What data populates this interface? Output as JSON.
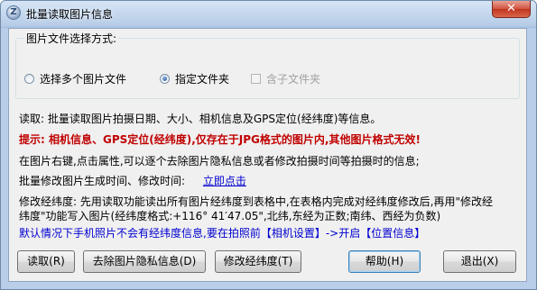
{
  "window": {
    "title": "批量读取图片信息",
    "close_label": "✕"
  },
  "group": {
    "legend": "图片文件选择方式:",
    "options": [
      {
        "label": "选择多个图片文件",
        "checked": false
      },
      {
        "label": "指定文件夹",
        "checked": true
      }
    ],
    "checkbox": {
      "label": "含子文件夹",
      "checked": false,
      "enabled": false
    }
  },
  "info": {
    "read_desc": "读取: 批量读取图片拍摄日期、大小、相机信息及GPS定位(经纬度)等信息。",
    "warning": "提示: 相机信息、GPS定位(经纬度),仅存在于JPG格式的图片内,其他图片格式无效!",
    "rightclick_desc": "在图片右键,点击属性,可以逐个去除图片隐私信息或者修改拍摄时间等拍摄时的信息;",
    "batch_time_label": "批量修改图片生成时间、修改时间:",
    "batch_time_link": "立即点击",
    "modify_line1": "修改经纬度: 先用读取功能读出所有图片经纬度到表格中,在表格内完成对经纬度修改后,再用\"修改经",
    "modify_line2": "纬度\"功能写入图片(经纬度格式:+116° 41′47.05\",北纬,东经为正数;南纬、西经为负数)",
    "phone_note": "默认情况下手机照片不会有经纬度信息,要在拍照前【相机设置】->开启【位置信息】"
  },
  "buttons": {
    "read": "读取(R)",
    "remove_privacy": "去除图片隐私信息(D)",
    "modify_gps": "修改经纬度(T)",
    "help": "帮助(H)",
    "exit": "退出(X)"
  }
}
